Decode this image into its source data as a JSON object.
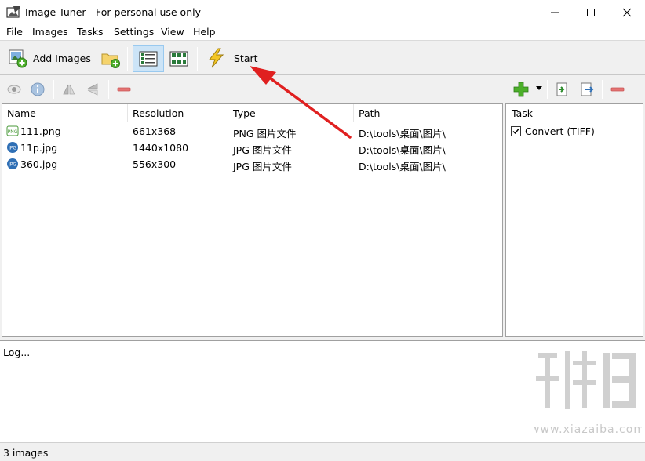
{
  "window": {
    "title": "Image Tuner - For personal use only",
    "icons": [
      "app-icon",
      "minimize-icon",
      "maximize-icon",
      "close-icon"
    ]
  },
  "menu": [
    "File",
    "Images",
    "Tasks",
    "Settings",
    "View",
    "Help"
  ],
  "toolbar": {
    "add_images_label": "Add Images",
    "start_label": "Start",
    "active_view": "details-view"
  },
  "files": {
    "columns": [
      "Name",
      "Resolution",
      "Type",
      "Path"
    ],
    "rows": [
      {
        "name": "111.png",
        "resolution": "661x368",
        "type": "PNG 图片文件",
        "path": "D:\\tools\\桌面\\图片\\",
        "badge": "png"
      },
      {
        "name": "11p.jpg",
        "resolution": "1440x1080",
        "type": "JPG 图片文件",
        "path": "D:\\tools\\桌面\\图片\\",
        "badge": "jpg"
      },
      {
        "name": "360.jpg",
        "resolution": "556x300",
        "type": "JPG 图片文件",
        "path": "D:\\tools\\桌面\\图片\\",
        "badge": "jpg"
      }
    ]
  },
  "tasks": {
    "header": "Task",
    "items": [
      {
        "label": "Convert (TIFF)",
        "checked": true
      }
    ]
  },
  "log": {
    "text": "Log..."
  },
  "status": {
    "text": "3 images"
  },
  "colors": {
    "arrow": "#e02020",
    "selected_view_bg": "#cce4f7",
    "png_badge": "#4a9a3a",
    "jpg_badge": "#2f6fb5",
    "add_green": "#4caf2a",
    "remove_red": "#e05555"
  }
}
